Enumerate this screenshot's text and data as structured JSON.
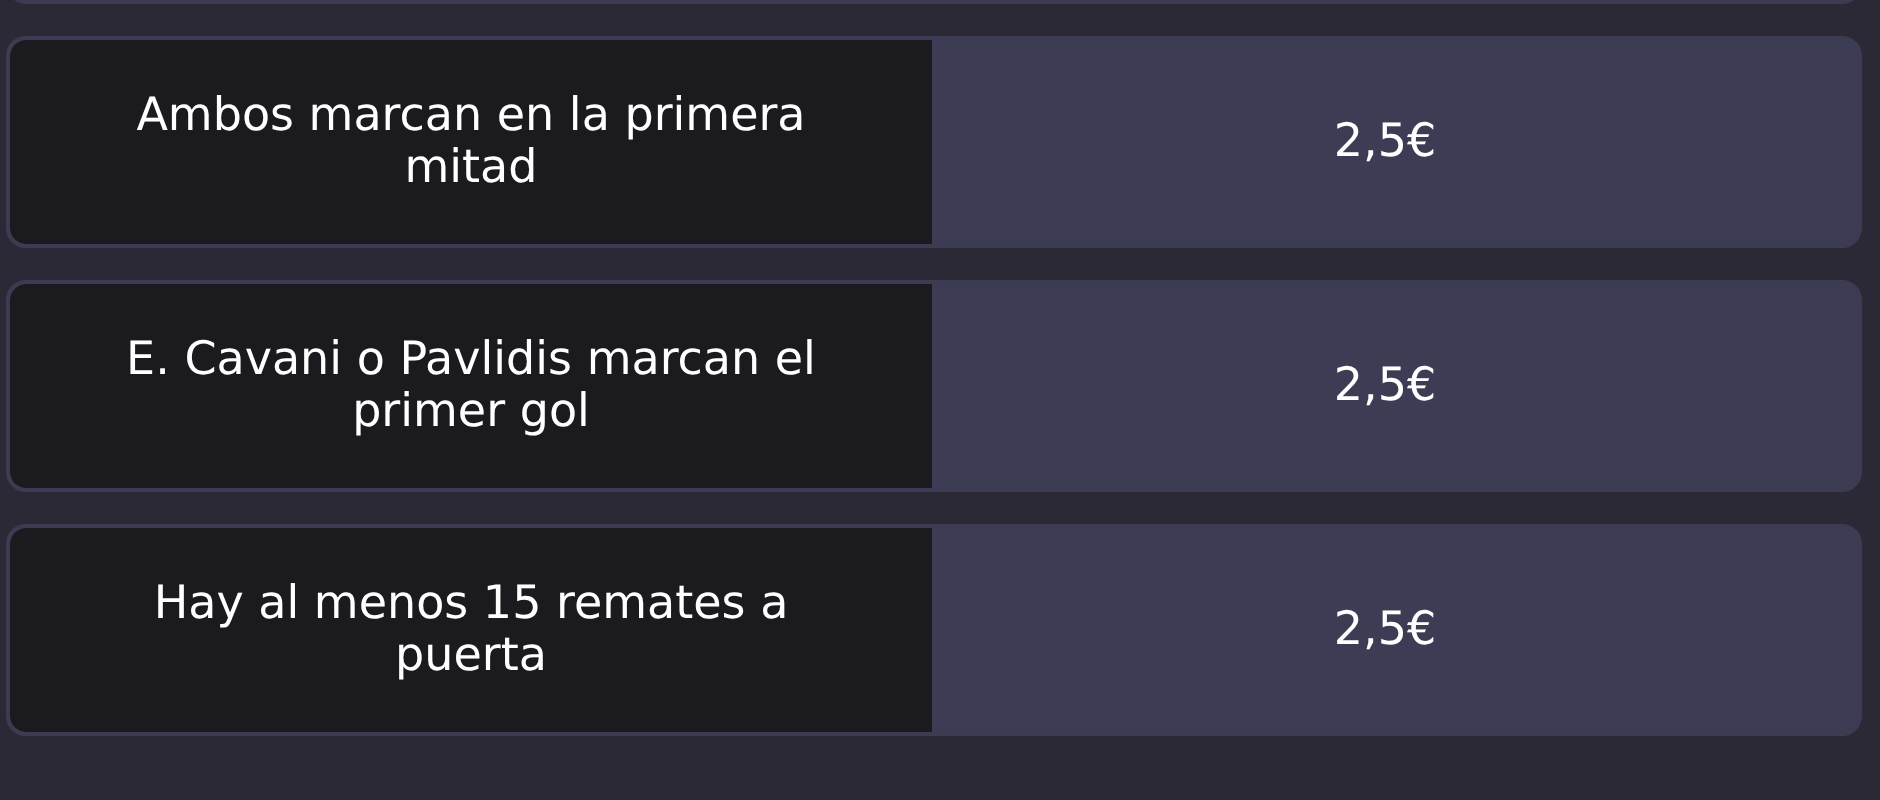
{
  "options": [
    {
      "label": "Ambos marcan en la primera mitad",
      "value": "2,5€"
    },
    {
      "label": "E. Cavani o Pavlidis marcan el primer gol",
      "value": "2,5€"
    },
    {
      "label": "Hay al menos 15 remates a puerta",
      "value": "2,5€"
    }
  ]
}
